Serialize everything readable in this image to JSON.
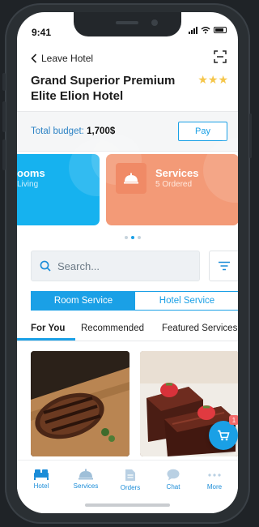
{
  "status": {
    "time": "9:41"
  },
  "header": {
    "back_label": "Leave Hotel",
    "hotel_name": "Grand Superior Premium Elite Elion Hotel",
    "stars": "★★★"
  },
  "budget": {
    "label": "Total budget:",
    "value": "1,700$",
    "pay_label": "Pay"
  },
  "cards": [
    {
      "title": "ooms",
      "subtitle": "Living"
    },
    {
      "title": "Services",
      "subtitle": "5 Ordered"
    }
  ],
  "search": {
    "placeholder": "Search..."
  },
  "segments": {
    "room_service": "Room Service",
    "hotel_service": "Hotel Service"
  },
  "subtabs": [
    "For You",
    "Recommended",
    "Featured Services"
  ],
  "cart": {
    "badge": "1"
  },
  "nav": [
    "Hotel",
    "Services",
    "Orders",
    "Chat",
    "More"
  ],
  "colors": {
    "accent": "#1aa0e6",
    "rooms_card": "#16b2ef",
    "services_card": "#f39a77",
    "stars": "#f5c64b"
  }
}
